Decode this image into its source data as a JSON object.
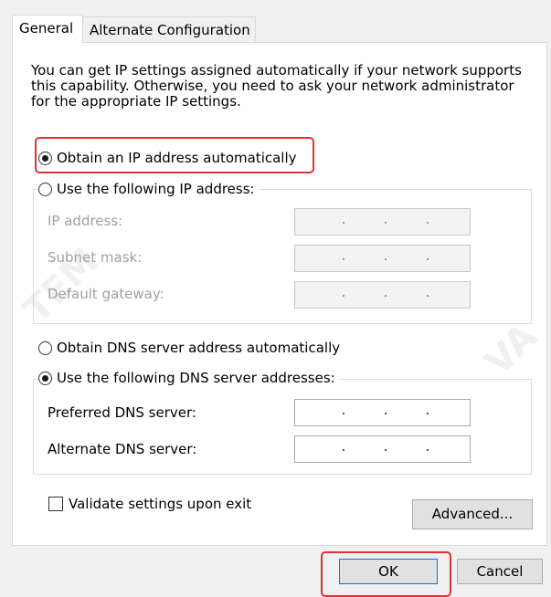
{
  "tabs": [
    "General",
    "Alternate Configuration"
  ],
  "description": "You can get IP settings assigned automatically if your network supports this capability. Otherwise, you need to ask your network administrator for the appropriate IP settings.",
  "ip": {
    "auto_label": "Obtain an IP address automatically",
    "manual_label": "Use the following IP address:",
    "fields": [
      {
        "label": "IP address:",
        "value": ". . ."
      },
      {
        "label": "Subnet mask:",
        "value": ". . ."
      },
      {
        "label": "Default gateway:",
        "value": ". . ."
      }
    ]
  },
  "dns": {
    "auto_label": "Obtain DNS server address automatically",
    "manual_label": "Use the following DNS server addresses:",
    "fields": [
      {
        "label": "Preferred DNS server:",
        "value": ". . ."
      },
      {
        "label": "Alternate DNS server:",
        "value": ". . ."
      }
    ]
  },
  "validate_label": "Validate settings upon exit",
  "buttons": {
    "advanced": "Advanced...",
    "ok": "OK",
    "cancel": "Cancel"
  },
  "watermarks": [
    "TEM",
    "VA"
  ],
  "colors": {
    "highlight": "#d9343a",
    "focus": "#0078d7"
  }
}
